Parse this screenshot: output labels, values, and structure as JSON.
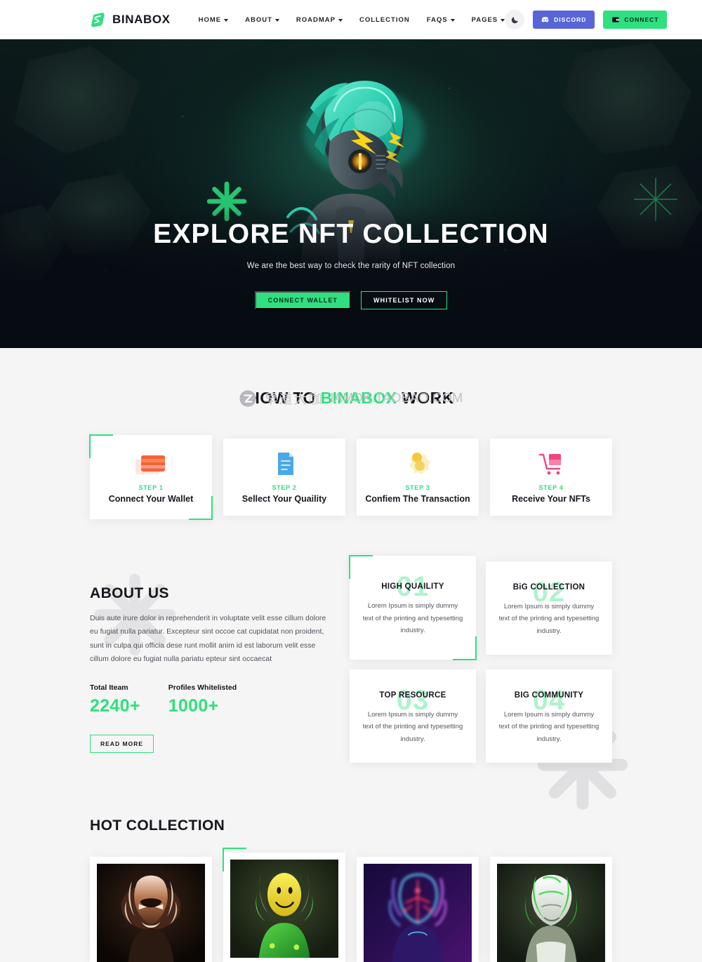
{
  "brand": {
    "name": "BINABOX",
    "logo_icon": "binabox-logo-icon",
    "accent": "#2ee07f"
  },
  "nav": {
    "items": [
      {
        "label": "HOME",
        "has_dropdown": true
      },
      {
        "label": "ABOUT",
        "has_dropdown": true
      },
      {
        "label": "ROADMAP",
        "has_dropdown": true
      },
      {
        "label": "COLLECTION",
        "has_dropdown": false
      },
      {
        "label": "FAQS",
        "has_dropdown": true
      },
      {
        "label": "PAGES",
        "has_dropdown": true
      }
    ],
    "theme_toggle_icon": "moon-icon",
    "discord": {
      "label": "DISCORD",
      "icon": "discord-icon",
      "color": "#5865d8"
    },
    "connect": {
      "label": "CONNECT",
      "icon": "wallet-icon",
      "color": "#2ee07f"
    }
  },
  "hero": {
    "title": "EXPLORE NFT COLLECTION",
    "subtitle": "We are the best way to check the rarity of NFT collection",
    "primary_button": "CONNECT WALLET",
    "secondary_button": "WHITELIST NOW"
  },
  "how_it_works": {
    "title_prefix": "HOW TO ",
    "title_highlight": "BINABOX",
    "title_suffix": " WORK",
    "steps": [
      {
        "step": "STEP 1",
        "title": "Connect Your Wallet",
        "icon": "credit-card-icon",
        "active": true
      },
      {
        "step": "STEP 2",
        "title": "Sellect Your Quaility",
        "icon": "document-icon",
        "active": false
      },
      {
        "step": "STEP 3",
        "title": "Confiem The Transaction",
        "icon": "gear-check-icon",
        "active": false
      },
      {
        "step": "STEP 4",
        "title": "Receive Your NFTs",
        "icon": "shopping-cart-icon",
        "active": false
      }
    ]
  },
  "about": {
    "title": "ABOUT US",
    "text": "Duis aute irure dolor in reprehenderit in voluptate velit esse cillum dolore eu fugiat nulla pariatur. Excepteur sint occoe cat cupidatat non proident, sunt in culpa qui officia dese runt mollit anim id est laborum velit esse cillum dolore eu fugiat nulla pariatu epteur sint occaecat",
    "stats": [
      {
        "label": "Total Iteam",
        "value": "2240+"
      },
      {
        "label": "Profiles Whitelisted",
        "value": "1000+"
      }
    ],
    "read_more": "READ MORE"
  },
  "features": [
    {
      "number": "01",
      "title": "HIGH QUAILITY",
      "text": "Lorem Ipsum is simply dummy text of the printing and typesetting industry.",
      "active": true
    },
    {
      "number": "02",
      "title": "BiG COLLECTION",
      "text": "Lorem Ipsum is simply dummy text of the printing and typesetting industry.",
      "active": false
    },
    {
      "number": "03",
      "title": "TOP RESOURCE",
      "text": "Lorem Ipsum is simply dummy text of the printing and typesetting industry.",
      "active": false
    },
    {
      "number": "04",
      "title": "BIG COMMUNITY",
      "text": "Lorem Ipsum is simply dummy text of the printing and typesetting industry.",
      "active": false
    }
  ],
  "hot_collection": {
    "title": "HOT COLLECTION",
    "items": [
      {
        "art": "bronze-alien-warrior",
        "active": false
      },
      {
        "art": "green-yellow-smiley-alien",
        "active": true
      },
      {
        "art": "neon-purple-red-alien",
        "active": false
      },
      {
        "art": "white-green-armored-alien",
        "active": false
      }
    ]
  },
  "watermark": {
    "cn": "早道大咖",
    "en": "IAMDK.TAOBAO.COM",
    "logo_icon": "z-circle-icon"
  }
}
